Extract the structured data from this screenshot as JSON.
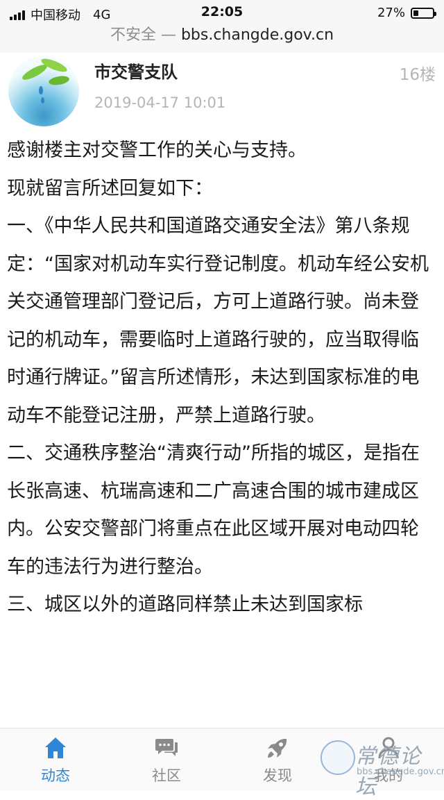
{
  "status_bar": {
    "carrier": "中国移动",
    "network": "4G",
    "time": "22:05",
    "battery_text": "27%",
    "battery_level": 0.27
  },
  "url_bar": {
    "insecure_label": "不安全 —",
    "host": "bbs.changde.gov.cn"
  },
  "post": {
    "author": "市交警支队",
    "timestamp": "2019-04-17 10:01",
    "floor": "16楼",
    "paragraphs": [
      "感谢楼主对交警工作的关心与支持。",
      "现就留言所述回复如下：",
      "一、《中华人民共和国道路交通安全法》第八条规定：“国家对机动车实行登记制度。机动车经公安机关交通管理部门登记后，方可上道路行驶。尚未登记的机动车，需要临时上道路行驶的，应当取得临时通行牌证。”留言所述情形，未达到国家标准的电动车不能登记注册，严禁上道路行驶。",
      "二、交通秩序整治“清爽行动”所指的城区，是指在长张高速、杭瑞高速和二广高速合围的城市建成区内。公安交警部门将重点在此区域开展对电动四轮车的违法行为进行整治。",
      "三、城区以外的道路同样禁止未达到国家标"
    ]
  },
  "tabbar": {
    "tabs": [
      {
        "label": "动态",
        "icon": "home-icon",
        "active": true
      },
      {
        "label": "社区",
        "icon": "chat-bubbles-icon",
        "active": false
      },
      {
        "label": "发现",
        "icon": "rocket-icon",
        "active": false
      },
      {
        "label": "我的",
        "icon": "user-icon",
        "active": false
      }
    ]
  },
  "watermark": {
    "title": "常德论坛",
    "url": "bbs.changde.gov.cn"
  },
  "colors": {
    "accent": "#2f86d6",
    "muted": "#b5b5b5",
    "tab_inactive": "#8a8a8a"
  }
}
